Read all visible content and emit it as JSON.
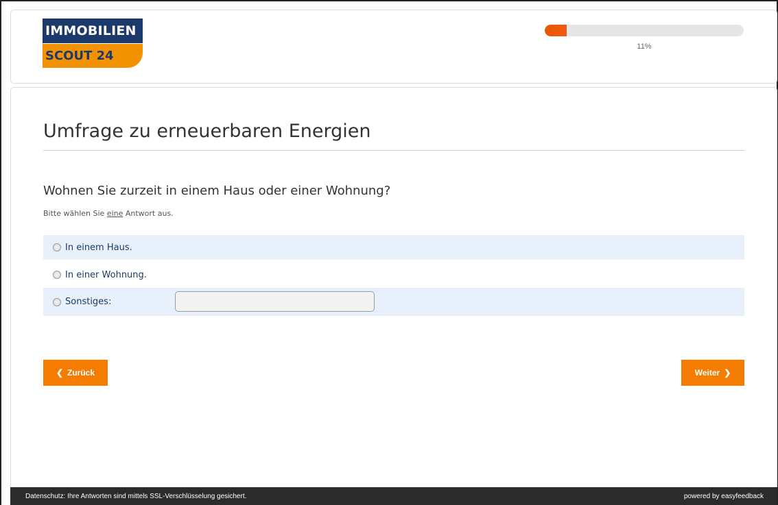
{
  "logo": {
    "line1": "IMMOBILIEN",
    "line2": "SCOUT 24"
  },
  "progress": {
    "value": 0.11,
    "label": "11%"
  },
  "survey": {
    "title": "Umfrage zu erneuerbaren Energien",
    "question": "Wohnen Sie zurzeit in einem Haus oder einer Wohnung?",
    "instruction_before": "Bitte wählen Sie ",
    "instruction_emph": "eine",
    "instruction_after": " Antwort aus.",
    "options": [
      {
        "label": "In einem Haus."
      },
      {
        "label": "In einer Wohnung."
      },
      {
        "label": "Sonstiges:"
      }
    ],
    "other_value": ""
  },
  "nav": {
    "back_label": "Zurück",
    "next_label": "Weiter"
  },
  "footer": {
    "privacy_text": "Datenschutz: Ihre Antworten sind mittels SSL-Verschlüsselung gesichert.",
    "powered_by": "powered by easyfeedback"
  },
  "colors": {
    "brand_blue": "#1b3a6b",
    "brand_orange": "#f39200",
    "button": "#f47c00",
    "progress": "#e85800"
  }
}
